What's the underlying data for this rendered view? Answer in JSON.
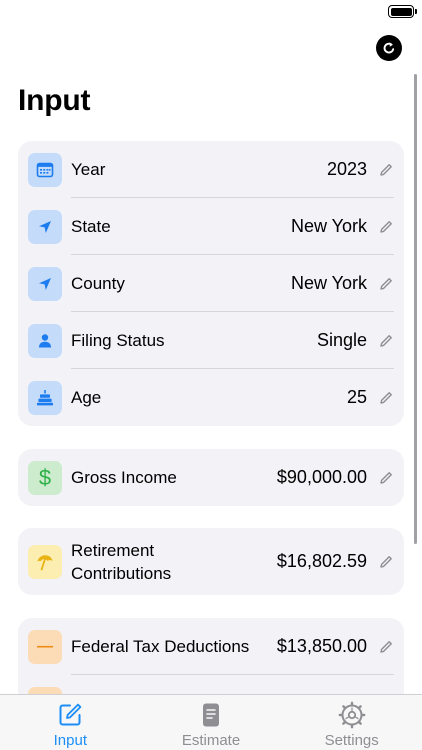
{
  "header": {
    "title": "Input"
  },
  "groups": [
    {
      "rows": [
        {
          "label": "Year",
          "value": "2023",
          "icon": "calendar-icon"
        },
        {
          "label": "State",
          "value": "New York",
          "icon": "location-arrow-icon"
        },
        {
          "label": "County",
          "value": "New York",
          "icon": "location-arrow-icon"
        },
        {
          "label": "Filing Status",
          "value": "Single",
          "icon": "person-icon"
        },
        {
          "label": "Age",
          "value": "25",
          "icon": "birthday-cake-icon"
        }
      ]
    },
    {
      "rows": [
        {
          "label": "Gross Income",
          "value": "$90,000.00",
          "icon": "dollar-sign-icon",
          "icon_glyph": "$"
        }
      ]
    },
    {
      "rows": [
        {
          "label_line1": "Retirement",
          "label_line2": "Contributions",
          "value": "$16,802.59",
          "icon": "beach-umbrella-icon"
        }
      ]
    },
    {
      "rows": [
        {
          "label": "Federal Tax Deductions",
          "value": "$13,850.00",
          "icon": "minus-icon",
          "icon_glyph": "—"
        }
      ]
    }
  ],
  "tabs": [
    {
      "label": "Input",
      "icon": "compose-icon",
      "active": true
    },
    {
      "label": "Estimate",
      "icon": "document-icon",
      "active": false
    },
    {
      "label": "Settings",
      "icon": "gear-icon",
      "active": false
    }
  ],
  "colors": {
    "accent": "#1c8ef6",
    "icon_blue": "#1c7cf0",
    "icon_green": "#2fb14a",
    "icon_yellow": "#e8b313",
    "icon_orange": "#f08a17",
    "group_bg": "#f2f2f7"
  }
}
